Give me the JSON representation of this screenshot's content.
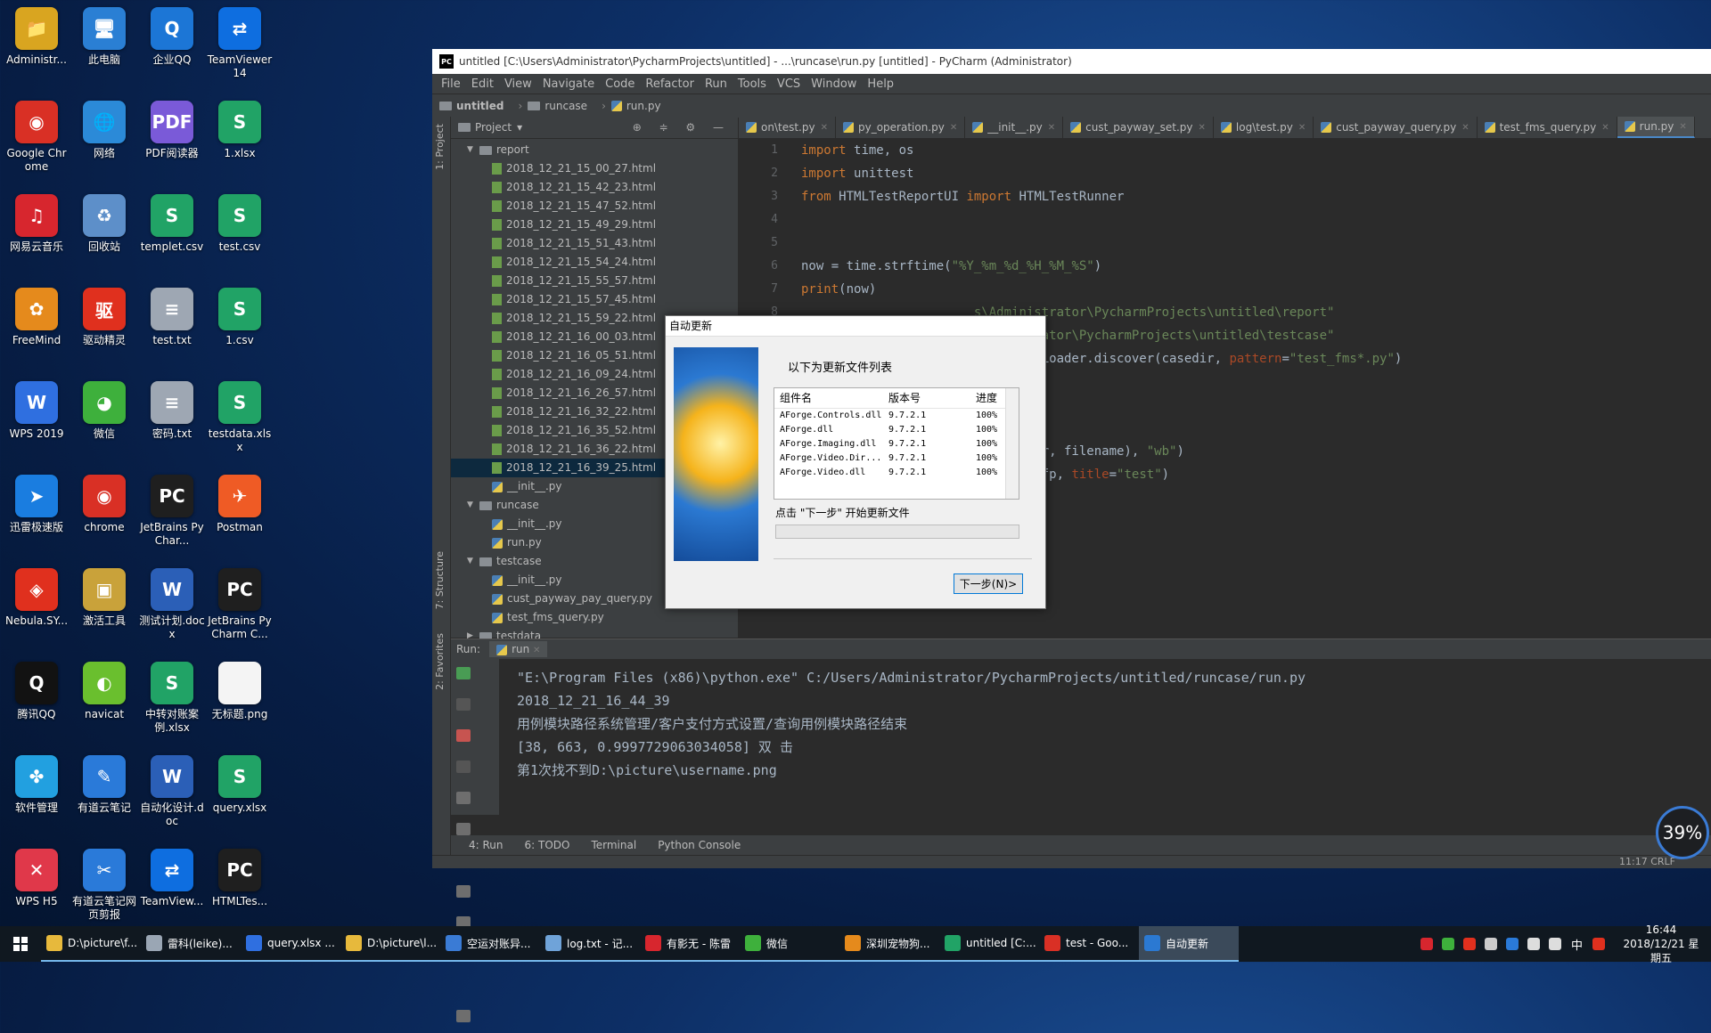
{
  "desktop": {
    "icons": [
      {
        "label": "Administr...",
        "color": "#d9a520",
        "glyph": "📁"
      },
      {
        "label": "此电脑",
        "color": "#2a7fd4",
        "glyph": "🖥"
      },
      {
        "label": "企业QQ",
        "color": "#1c76d6",
        "glyph": "Q"
      },
      {
        "label": "TeamViewer 14",
        "color": "#0e6ee0",
        "glyph": "⇄"
      },
      {
        "label": "Google Chrome",
        "color": "#d93025",
        "glyph": "◉"
      },
      {
        "label": "网络",
        "color": "#2b8ad8",
        "glyph": "🌐"
      },
      {
        "label": "PDF阅读器",
        "color": "#7a5ad8",
        "glyph": "PDF"
      },
      {
        "label": "1.xlsx",
        "color": "#21a366",
        "glyph": "S"
      },
      {
        "label": "网易云音乐",
        "color": "#d7262e",
        "glyph": "♫"
      },
      {
        "label": "回收站",
        "color": "#5d8fc9",
        "glyph": "♻"
      },
      {
        "label": "templet.csv",
        "color": "#21a366",
        "glyph": "S"
      },
      {
        "label": "test.csv",
        "color": "#21a366",
        "glyph": "S"
      },
      {
        "label": "FreeMind",
        "color": "#e58a1c",
        "glyph": "✿"
      },
      {
        "label": "驱动精灵",
        "color": "#e0301e",
        "glyph": "驱"
      },
      {
        "label": "test.txt",
        "color": "#9ea7b3",
        "glyph": "≡"
      },
      {
        "label": "1.csv",
        "color": "#21a366",
        "glyph": "S"
      },
      {
        "label": "WPS 2019",
        "color": "#2f6fe0",
        "glyph": "W"
      },
      {
        "label": "微信",
        "color": "#3eb03c",
        "glyph": "◕"
      },
      {
        "label": "密码.txt",
        "color": "#9ea7b3",
        "glyph": "≡"
      },
      {
        "label": "testdata.xlsx",
        "color": "#21a366",
        "glyph": "S"
      },
      {
        "label": "迅雷极速版",
        "color": "#1a7de0",
        "glyph": "➤"
      },
      {
        "label": "chrome",
        "color": "#d93025",
        "glyph": "◉"
      },
      {
        "label": "JetBrains PyChar...",
        "color": "#1f1f1f",
        "glyph": "PC"
      },
      {
        "label": "Postman",
        "color": "#ef5b25",
        "glyph": "✈"
      },
      {
        "label": "Nebula.SY...",
        "color": "#e0301e",
        "glyph": "◈"
      },
      {
        "label": "激活工具",
        "color": "#c9a23a",
        "glyph": "▣"
      },
      {
        "label": "测试计划.docx",
        "color": "#2b5fb7",
        "glyph": "W"
      },
      {
        "label": "JetBrains PyCharm C...",
        "color": "#1f1f1f",
        "glyph": "PC"
      },
      {
        "label": "腾讯QQ",
        "color": "#121212",
        "glyph": "Q"
      },
      {
        "label": "navicat",
        "color": "#6abf2e",
        "glyph": "◐"
      },
      {
        "label": "中转对账案例.xlsx",
        "color": "#21a366",
        "glyph": "S"
      },
      {
        "label": "无标题.png",
        "color": "#f4f4f4",
        "glyph": ""
      },
      {
        "label": "软件管理",
        "color": "#22a0e0",
        "glyph": "✤"
      },
      {
        "label": "有道云笔记",
        "color": "#2a7ad9",
        "glyph": "✎"
      },
      {
        "label": "自动化设计.doc",
        "color": "#2b5fb7",
        "glyph": "W"
      },
      {
        "label": "query.xlsx",
        "color": "#21a366",
        "glyph": "S"
      },
      {
        "label": "WPS H5",
        "color": "#e0384a",
        "glyph": "✕"
      },
      {
        "label": "有道云笔记网页剪报",
        "color": "#2a7ad9",
        "glyph": "✂"
      },
      {
        "label": "TeamView...",
        "color": "#0e6ee0",
        "glyph": "⇄"
      },
      {
        "label": "HTMLTes...",
        "color": "#1f1f1f",
        "glyph": "PC"
      }
    ]
  },
  "pycharm": {
    "title": "untitled [C:\\Users\\Administrator\\PycharmProjects\\untitled] - ...\\runcase\\run.py [untitled] - PyCharm (Administrator)",
    "menu": [
      "File",
      "Edit",
      "View",
      "Navigate",
      "Code",
      "Refactor",
      "Run",
      "Tools",
      "VCS",
      "Window",
      "Help"
    ],
    "breadcrumb": [
      "untitled",
      "runcase",
      "run.py"
    ],
    "sidebar_tabs": [
      "1: Project",
      "7: Structure",
      "2: Favorites"
    ],
    "project_label": "Project",
    "tree": [
      {
        "label": "report",
        "type": "folder",
        "depth": 1,
        "open": true
      },
      {
        "label": "2018_12_21_15_00_27.html",
        "type": "html",
        "depth": 2
      },
      {
        "label": "2018_12_21_15_42_23.html",
        "type": "html",
        "depth": 2
      },
      {
        "label": "2018_12_21_15_47_52.html",
        "type": "html",
        "depth": 2
      },
      {
        "label": "2018_12_21_15_49_29.html",
        "type": "html",
        "depth": 2
      },
      {
        "label": "2018_12_21_15_51_43.html",
        "type": "html",
        "depth": 2
      },
      {
        "label": "2018_12_21_15_54_24.html",
        "type": "html",
        "depth": 2
      },
      {
        "label": "2018_12_21_15_55_57.html",
        "type": "html",
        "depth": 2
      },
      {
        "label": "2018_12_21_15_57_45.html",
        "type": "html",
        "depth": 2
      },
      {
        "label": "2018_12_21_15_59_22.html",
        "type": "html",
        "depth": 2
      },
      {
        "label": "2018_12_21_16_00_03.html",
        "type": "html",
        "depth": 2
      },
      {
        "label": "2018_12_21_16_05_51.html",
        "type": "html",
        "depth": 2
      },
      {
        "label": "2018_12_21_16_09_24.html",
        "type": "html",
        "depth": 2
      },
      {
        "label": "2018_12_21_16_26_57.html",
        "type": "html",
        "depth": 2
      },
      {
        "label": "2018_12_21_16_32_22.html",
        "type": "html",
        "depth": 2
      },
      {
        "label": "2018_12_21_16_35_52.html",
        "type": "html",
        "depth": 2
      },
      {
        "label": "2018_12_21_16_36_22.html",
        "type": "html",
        "depth": 2
      },
      {
        "label": "2018_12_21_16_39_25.html",
        "type": "html",
        "depth": 2,
        "selected": true
      },
      {
        "label": "__init__.py",
        "type": "py",
        "depth": 2
      },
      {
        "label": "runcase",
        "type": "folder",
        "depth": 1,
        "open": true
      },
      {
        "label": "__init__.py",
        "type": "py",
        "depth": 2
      },
      {
        "label": "run.py",
        "type": "py",
        "depth": 2
      },
      {
        "label": "testcase",
        "type": "folder",
        "depth": 1,
        "open": true
      },
      {
        "label": "__init__.py",
        "type": "py",
        "depth": 2
      },
      {
        "label": "cust_payway_pay_query.py",
        "type": "py",
        "depth": 2
      },
      {
        "label": "test_fms_query.py",
        "type": "py",
        "depth": 2
      },
      {
        "label": "testdata",
        "type": "folder",
        "depth": 1,
        "open": false
      }
    ],
    "tabs": [
      {
        "label": "on\\test.py"
      },
      {
        "label": "py_operation.py"
      },
      {
        "label": "__init__.py"
      },
      {
        "label": "cust_payway_set.py"
      },
      {
        "label": "log\\test.py"
      },
      {
        "label": "cust_payway_query.py"
      },
      {
        "label": "test_fms_query.py"
      },
      {
        "label": "run.py",
        "active": true
      }
    ],
    "line_numbers": [
      "1",
      "2",
      "3",
      "4",
      "5",
      "6",
      "7",
      "8",
      "9",
      "10",
      "11",
      "12",
      "13",
      "14",
      "15"
    ],
    "code": [
      [
        {
          "t": "import ",
          "c": "kw"
        },
        {
          "t": "time, os"
        }
      ],
      [
        {
          "t": "import ",
          "c": "kw"
        },
        {
          "t": "unittest"
        }
      ],
      [
        {
          "t": "from ",
          "c": "kw"
        },
        {
          "t": "HTMLTestReportUI "
        },
        {
          "t": "import ",
          "c": "kw"
        },
        {
          "t": "HTMLTestRunner"
        }
      ],
      [],
      [],
      [
        {
          "t": "now = time.strftime("
        },
        {
          "t": "\"%Y_%m_%d_%H_%M_%S\"",
          "c": "str"
        },
        {
          "t": ")"
        }
      ],
      [
        {
          "t": "print",
          "c": "kw"
        },
        {
          "t": "(now)"
        }
      ],
      [
        {
          "t": "                       "
        },
        {
          "t": "s\\Administrator\\PycharmProjects\\untitled\\report\"",
          "c": "str"
        }
      ],
      [
        {
          "t": "                       "
        },
        {
          "t": "Administrator\\PycharmProjects\\untitled\\testcase\"",
          "c": "str"
        }
      ],
      [
        {
          "t": "                      efaultTestLoader.discover(casedir, "
        },
        {
          "t": "pattern",
          "c": "param"
        },
        {
          "t": "="
        },
        {
          "t": "\"test_fms*.py\"",
          "c": "str"
        },
        {
          "t": ")"
        }
      ],
      [],
      [
        {
          "t": "                      "
        },
        {
          "t": "ml\"",
          "c": "str"
        }
      ],
      [],
      [
        {
          "t": "                      n(reportdir, filename), "
        },
        {
          "t": "\"wb\"",
          "c": "str"
        },
        {
          "t": ")"
        }
      ],
      [
        {
          "t": "                      er("
        },
        {
          "t": "stream",
          "c": "param"
        },
        {
          "t": "=fp, "
        },
        {
          "t": "title",
          "c": "param"
        },
        {
          "t": "="
        },
        {
          "t": "\"test\"",
          "c": "str"
        },
        {
          "t": ")"
        }
      ]
    ],
    "run": {
      "label": "Run:",
      "tab": "run",
      "output": [
        "\"E:\\Program Files (x86)\\python.exe\" C:/Users/Administrator/PycharmProjects/untitled/runcase/run.py",
        "2018_12_21_16_44_39",
        "用例模块路径系统管理/客户支付方式设置/查询用例模块路径结束",
        "[38, 663, 0.9997729063034058] 双 击",
        "第1次找不到D:\\picture\\username.png"
      ]
    },
    "bottom_tabs": [
      "4: Run",
      "6: TODO",
      "Terminal",
      "Python Console"
    ],
    "status": "11:17   CRLF",
    "cpu": "39%"
  },
  "dialog": {
    "title": "自动更新",
    "heading": "以下为更新文件列表",
    "columns": [
      "组件名",
      "版本号",
      "进度"
    ],
    "rows": [
      [
        "AForge.Controls.dll",
        "9.7.2.1",
        "100%"
      ],
      [
        "AForge.dll",
        "9.7.2.1",
        "100%"
      ],
      [
        "AForge.Imaging.dll",
        "9.7.2.1",
        "100%"
      ],
      [
        "AForge.Video.Dir...",
        "9.7.2.1",
        "100%"
      ],
      [
        "AForge.Video.dll",
        "9.7.2.1",
        "100%"
      ]
    ],
    "hint": "点击 \"下一步\" 开始更新文件",
    "next_button": "下一步(N)>"
  },
  "taskbar": {
    "tasks": [
      {
        "label": "D:\\picture\\f...",
        "color": "#e7b93c"
      },
      {
        "label": "雷科(leike)...",
        "color": "#9aa6b4"
      },
      {
        "label": "query.xlsx ...",
        "color": "#2f6fe0"
      },
      {
        "label": "D:\\picture\\l...",
        "color": "#e7b93c"
      },
      {
        "label": "空运对账异...",
        "color": "#3a7bd5"
      },
      {
        "label": "log.txt - 记...",
        "color": "#6fa3d9"
      },
      {
        "label": "有影无 - 陈雷",
        "color": "#d7262e"
      },
      {
        "label": "微信",
        "color": "#3eb03c"
      },
      {
        "label": "深圳宠物狗...",
        "color": "#e58a1c"
      },
      {
        "label": "untitled [C:...",
        "color": "#21a366"
      },
      {
        "label": "test - Goo...",
        "color": "#d93025"
      },
      {
        "label": "自动更新",
        "color": "#2b79d2",
        "active": true
      }
    ],
    "ime": "中",
    "time": "16:44",
    "date": "2018/12/21 星期五"
  }
}
